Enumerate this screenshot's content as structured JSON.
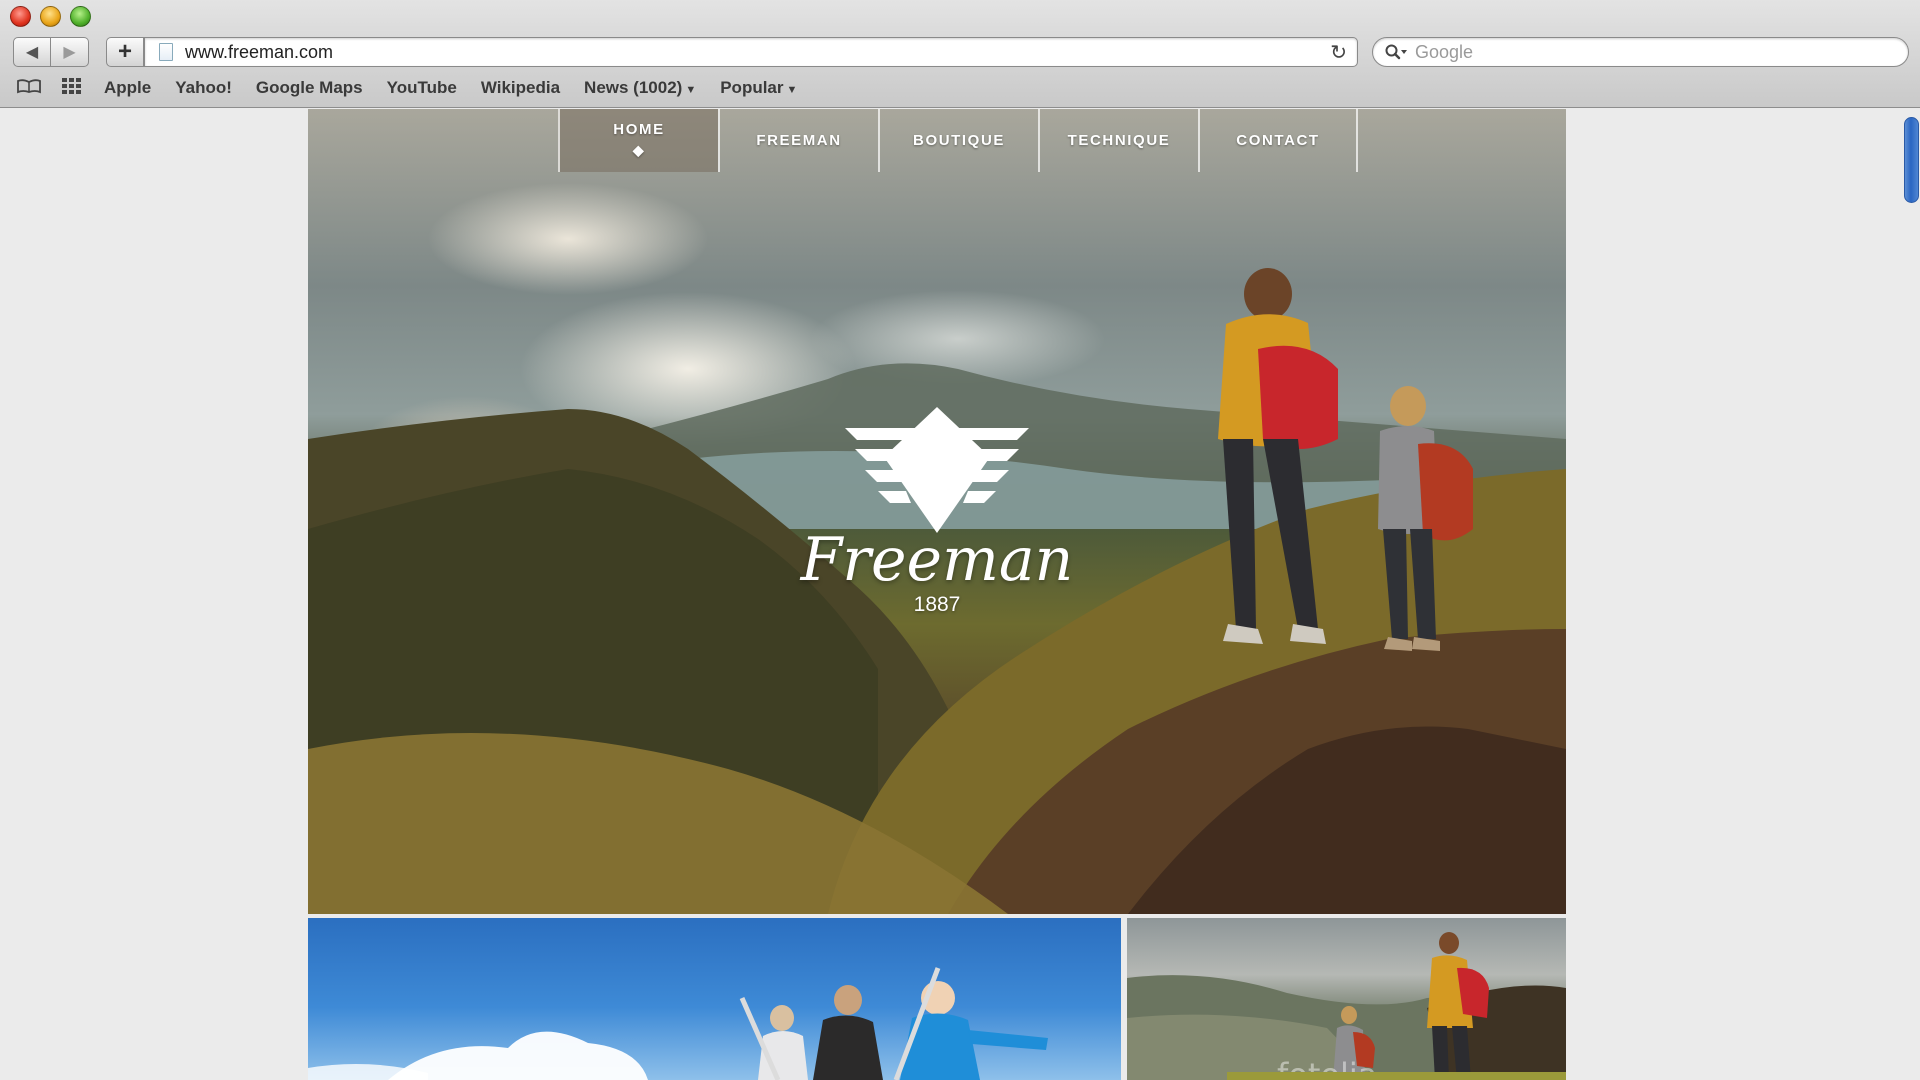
{
  "browser": {
    "url": "www.freeman.com",
    "search_placeholder": "Google",
    "bookmarks": [
      "Apple",
      "Yahoo!",
      "Google Maps",
      "YouTube",
      "Wikipedia",
      "News (1002)",
      "Popular"
    ]
  },
  "site": {
    "nav": [
      {
        "label": "HOME",
        "active": true
      },
      {
        "label": "FREEMAN",
        "active": false
      },
      {
        "label": "BOUTIQUE",
        "active": false
      },
      {
        "label": "TECHNIQUE",
        "active": false
      },
      {
        "label": "CONTACT",
        "active": false
      }
    ],
    "brand_name": "Freeman",
    "brand_year": "1887",
    "thumb2_watermark": "fotolia"
  },
  "colors": {
    "scroll_thumb": "#2a66c2",
    "nav_active_bg": "#786e5f"
  }
}
